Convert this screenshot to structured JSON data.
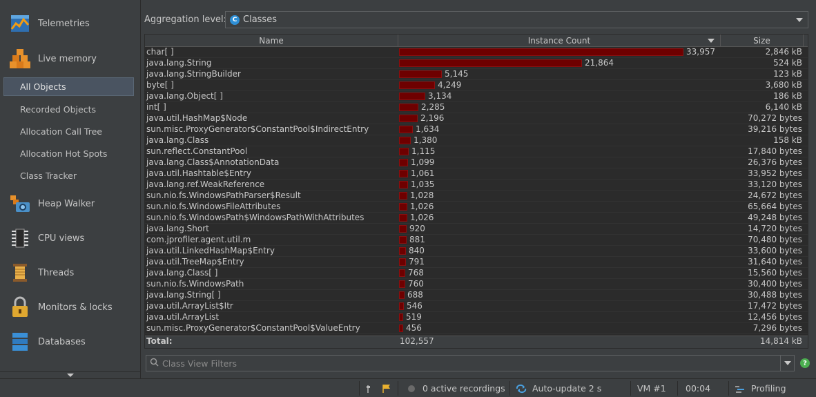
{
  "sidebar": {
    "items": [
      {
        "label": "Telemetries",
        "icon": "telemetries-icon"
      },
      {
        "label": "Live memory",
        "icon": "live-memory-icon"
      },
      {
        "label": "Heap Walker",
        "icon": "heap-walker-icon"
      },
      {
        "label": "CPU views",
        "icon": "cpu-views-icon"
      },
      {
        "label": "Threads",
        "icon": "threads-icon"
      },
      {
        "label": "Monitors & locks",
        "icon": "monitors-locks-icon"
      },
      {
        "label": "Databases",
        "icon": "databases-icon"
      }
    ],
    "live_memory_sub": [
      {
        "label": "All Objects",
        "selected": true
      },
      {
        "label": "Recorded Objects",
        "selected": false
      },
      {
        "label": "Allocation Call Tree",
        "selected": false
      },
      {
        "label": "Allocation Hot Spots",
        "selected": false
      },
      {
        "label": "Class Tracker",
        "selected": false
      }
    ]
  },
  "aggregation": {
    "label": "Aggregation level:",
    "value": "Classes",
    "icon_letter": "C"
  },
  "table": {
    "columns": [
      "Name",
      "Instance Count",
      "Size"
    ],
    "sorted_column": "Instance Count",
    "max_count": 33957,
    "rows": [
      {
        "name": "char[ ]",
        "count": 33957,
        "count_text": "33,957",
        "size": "2,846 kB"
      },
      {
        "name": "java.lang.String",
        "count": 21864,
        "count_text": "21,864",
        "size": "524 kB"
      },
      {
        "name": "java.lang.StringBuilder",
        "count": 5145,
        "count_text": "5,145",
        "size": "123 kB"
      },
      {
        "name": "byte[ ]",
        "count": 4249,
        "count_text": "4,249",
        "size": "3,680 kB"
      },
      {
        "name": "java.lang.Object[ ]",
        "count": 3134,
        "count_text": "3,134",
        "size": "186 kB"
      },
      {
        "name": "int[ ]",
        "count": 2285,
        "count_text": "2,285",
        "size": "6,140 kB"
      },
      {
        "name": "java.util.HashMap$Node",
        "count": 2196,
        "count_text": "2,196",
        "size": "70,272 bytes"
      },
      {
        "name": "sun.misc.ProxyGenerator$ConstantPool$IndirectEntry",
        "count": 1634,
        "count_text": "1,634",
        "size": "39,216 bytes"
      },
      {
        "name": "java.lang.Class",
        "count": 1380,
        "count_text": "1,380",
        "size": "158 kB"
      },
      {
        "name": "sun.reflect.ConstantPool",
        "count": 1115,
        "count_text": "1,115",
        "size": "17,840 bytes"
      },
      {
        "name": "java.lang.Class$AnnotationData",
        "count": 1099,
        "count_text": "1,099",
        "size": "26,376 bytes"
      },
      {
        "name": "java.util.Hashtable$Entry",
        "count": 1061,
        "count_text": "1,061",
        "size": "33,952 bytes"
      },
      {
        "name": "java.lang.ref.WeakReference",
        "count": 1035,
        "count_text": "1,035",
        "size": "33,120 bytes"
      },
      {
        "name": "sun.nio.fs.WindowsPathParser$Result",
        "count": 1028,
        "count_text": "1,028",
        "size": "24,672 bytes"
      },
      {
        "name": "sun.nio.fs.WindowsFileAttributes",
        "count": 1026,
        "count_text": "1,026",
        "size": "65,664 bytes"
      },
      {
        "name": "sun.nio.fs.WindowsPath$WindowsPathWithAttributes",
        "count": 1026,
        "count_text": "1,026",
        "size": "49,248 bytes"
      },
      {
        "name": "java.lang.Short",
        "count": 920,
        "count_text": "920",
        "size": "14,720 bytes"
      },
      {
        "name": "com.jprofiler.agent.util.m",
        "count": 881,
        "count_text": "881",
        "size": "70,480 bytes"
      },
      {
        "name": "java.util.LinkedHashMap$Entry",
        "count": 840,
        "count_text": "840",
        "size": "33,600 bytes"
      },
      {
        "name": "java.util.TreeMap$Entry",
        "count": 791,
        "count_text": "791",
        "size": "31,640 bytes"
      },
      {
        "name": "java.lang.Class[ ]",
        "count": 768,
        "count_text": "768",
        "size": "15,560 bytes"
      },
      {
        "name": "sun.nio.fs.WindowsPath",
        "count": 760,
        "count_text": "760",
        "size": "30,400 bytes"
      },
      {
        "name": "java.lang.String[ ]",
        "count": 688,
        "count_text": "688",
        "size": "30,488 bytes"
      },
      {
        "name": "java.util.ArrayList$Itr",
        "count": 546,
        "count_text": "546",
        "size": "17,472 bytes"
      },
      {
        "name": "java.util.ArrayList",
        "count": 519,
        "count_text": "519",
        "size": "12,456 bytes"
      },
      {
        "name": "sun.misc.ProxyGenerator$ConstantPool$ValueEntry",
        "count": 456,
        "count_text": "456",
        "size": "7,296 bytes"
      }
    ],
    "total": {
      "label": "Total:",
      "count": "102,557",
      "size": "14,814 kB"
    }
  },
  "filter": {
    "placeholder": "Class View Filters"
  },
  "status": {
    "recordings": "0 active recordings",
    "autoupdate": "Auto-update 2 s",
    "vm": "VM #1",
    "time": "00:04",
    "profiling": "Profiling"
  },
  "colors": {
    "bar": "#6e0000",
    "background": "#3c3f41",
    "table_bg": "#2b2b2b",
    "selected": "#4a5461"
  }
}
